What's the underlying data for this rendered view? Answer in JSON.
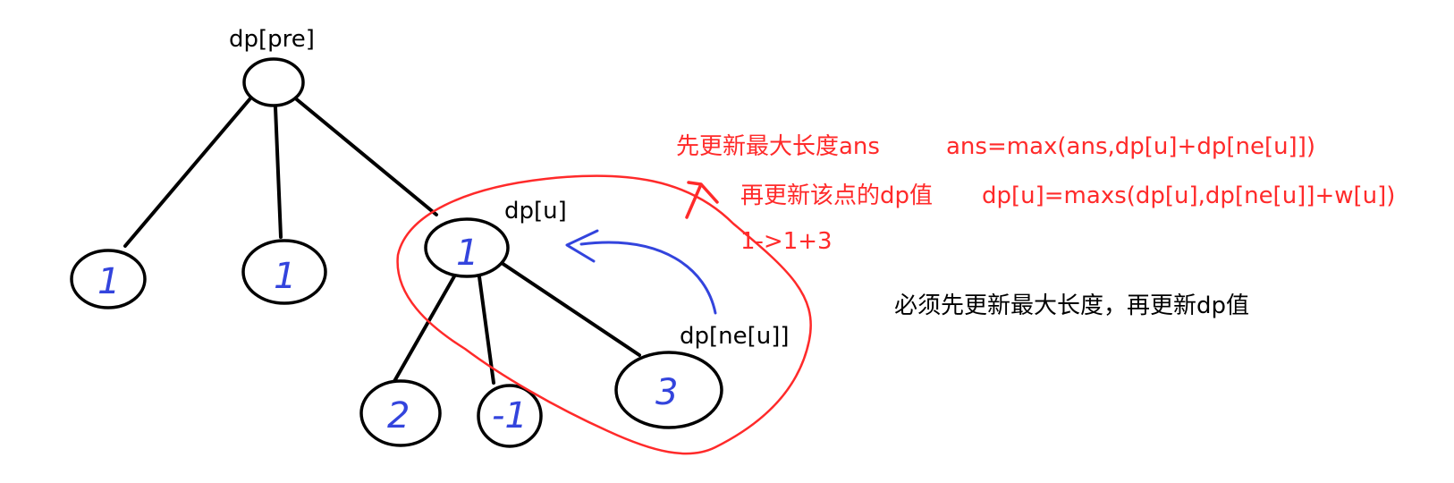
{
  "colors": {
    "edge": "#000000",
    "annotation": "#ff2a2a",
    "handwriting": "#3344dd",
    "note": "#000000"
  },
  "labels": {
    "dp_pre": "dp[pre]",
    "dp_u": "dp[u]",
    "dp_ne_u": "dp[ne[u]]"
  },
  "nodes": {
    "left": "1",
    "middle": "1",
    "u": "1",
    "child_a": "2",
    "child_b": "-1",
    "ne_u": "3"
  },
  "annotations": {
    "step1_text": "先更新最大长度ans",
    "step1_formula": "ans=max(ans,dp[u]+dp[ne[u]])",
    "step2_text": "再更新该点的dp值",
    "step2_formula": "dp[u]=maxs(dp[u],dp[ne[u]]+w[u])",
    "step2_example": "1->1+3"
  },
  "note": "必须先更新最大长度，再更新dp值"
}
